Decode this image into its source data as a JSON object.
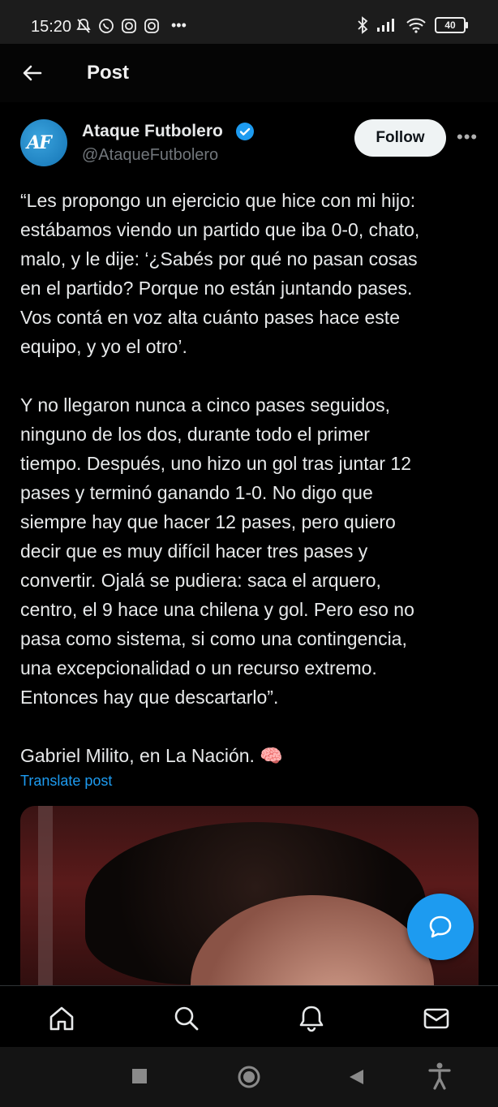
{
  "status_bar": {
    "time": "15:20",
    "battery": "40",
    "left_icons": [
      "mute-bell-icon",
      "whatsapp-icon",
      "instagram-icon",
      "instagram-icon",
      "more-dots"
    ],
    "right_icons": [
      "bluetooth-icon",
      "signal-icon",
      "wifi-icon",
      "battery-icon"
    ]
  },
  "header": {
    "title": "Post",
    "back_icon": "back-arrow-icon"
  },
  "post": {
    "author_name": "Ataque Futbolero",
    "author_handle": "@AtaqueFutbolero",
    "avatar_text": "AF",
    "follow_label": "Follow",
    "more_label": "•••",
    "text": "“Les propongo un ejercicio que hice con mi hijo:\nestábamos viendo un partido que iba 0-0, chato,\nmalo, y le dije: ‘¿Sabés por qué no pasan cosas\nen el partido? Porque no están juntando pases.\nVos contá en voz alta cuánto pases hace este\nequipo, y yo el otro’.\n\nY no llegaron nunca a cinco pases seguidos,\nninguno de los dos, durante todo el primer\ntiempo. Después, uno hizo un gol tras juntar 12\npases y terminó ganando 1-0. No digo que\nsiempre hay que hacer 12 pases, pero quiero\ndecir que es muy difícil hacer tres pases y\nconvertir. Ojalá se pudiera: saca el arquero,\ncentro, el 9 hace una chilena y gol. Pero eso no\npasa como sistema, si como una contingencia,\nuna excepcionalidad o un recurso extremo.\nEntonces hay que descartarlo”.\n\nGabriel Milito, en La Nación. 🧠",
    "translate_label": "Translate post"
  },
  "bottom_nav": [
    "home-icon",
    "search-icon",
    "notifications-icon",
    "messages-icon"
  ],
  "colors": {
    "accent": "#1d9bf0",
    "background": "#000000",
    "text": "#e7e9ea",
    "muted": "#71767b"
  }
}
